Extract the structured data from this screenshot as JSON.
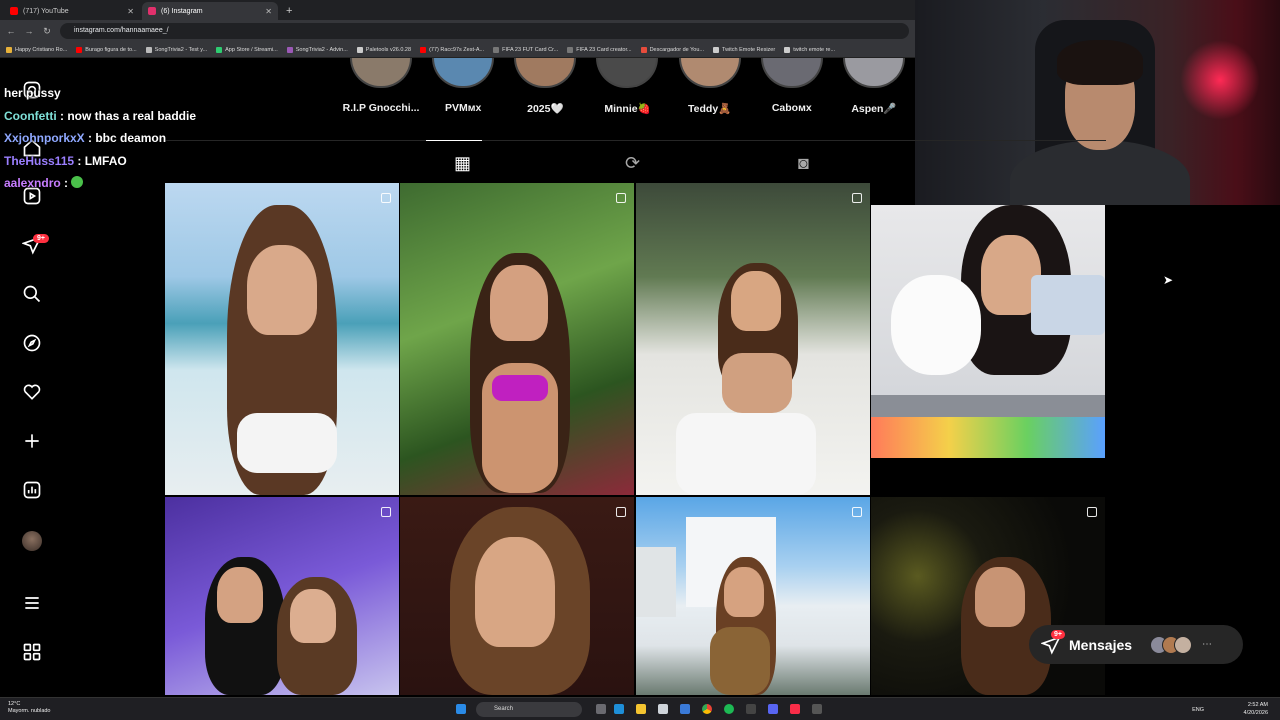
{
  "browser": {
    "tabs": [
      {
        "title": "(717) YouTube",
        "color": "#ff0000"
      },
      {
        "title": "(6) Instagram",
        "color": "#e1306c"
      }
    ],
    "new_tab": "+",
    "url": "instagram.com/hannaamaee_/",
    "bookmarks": [
      {
        "label": "Happy Cristiano Ro...",
        "color": "#e8b23a"
      },
      {
        "label": "Burago figura de to...",
        "color": "#ff0000"
      },
      {
        "label": "SongTrivia2 - Test y...",
        "color": "#bbbbbb"
      },
      {
        "label": "App Store / Streami...",
        "color": "#2ecc71"
      },
      {
        "label": "SongTrivia2 - Advin...",
        "color": "#9b59b6"
      },
      {
        "label": "Paletools v26.0.28",
        "color": "#cccccc"
      },
      {
        "label": "(77) Racc97s Zest-A...",
        "color": "#ff0000"
      },
      {
        "label": "FIFA 23 FUT Card Cr...",
        "color": "#777777"
      },
      {
        "label": "FIFA 23 Card creator...",
        "color": "#777777"
      },
      {
        "label": "Descargador de You...",
        "color": "#e74c3c"
      },
      {
        "label": "Twitch Emote Resizer",
        "color": "#cccccc"
      },
      {
        "label": "twitch emote re...",
        "color": "#cccccc"
      }
    ]
  },
  "stories": [
    {
      "label": "R.I.P Gnocchi..."
    },
    {
      "label": "PVMᴍx"
    },
    {
      "label": "2025🤍"
    },
    {
      "label": "Minnie🍓"
    },
    {
      "label": "Teddy🧸"
    },
    {
      "label": "Caboᴍx"
    },
    {
      "label": "Aspen🎤"
    }
  ],
  "chat": [
    {
      "user": "her pussy",
      "msg": "",
      "color": "#ffffff"
    },
    {
      "user": "Coonfetti",
      "msg": " : now thas a real baddie",
      "color": "#7fe0d8"
    },
    {
      "user": "XxjohnporkxX",
      "msg": " : bbc deamon",
      "color": "#8fa8ff"
    },
    {
      "user": "TheHuss115",
      "msg": " : LMFAO",
      "color": "#9b7fff"
    },
    {
      "user": "aalexndro",
      "msg": " : ",
      "color": "#c77dff"
    }
  ],
  "sidebar": {
    "notif_count": "9+",
    "items": [
      "instagram-logo",
      "home",
      "reels",
      "messages",
      "search",
      "explore",
      "notifications",
      "create",
      "dashboard",
      "profile",
      "more",
      "also-from-meta"
    ]
  },
  "messages_button": {
    "label": "Mensajes",
    "badge": "9+"
  },
  "taskbar": {
    "weather_temp": "12°C",
    "weather_desc": "Mayorm. nublado",
    "search": "Search",
    "lang": "ENG",
    "time": "2:52 AM",
    "date": "4/20/2026"
  },
  "colors": {
    "accent": "#0095f6",
    "badge": "#ff3040",
    "bg": "#000000"
  }
}
